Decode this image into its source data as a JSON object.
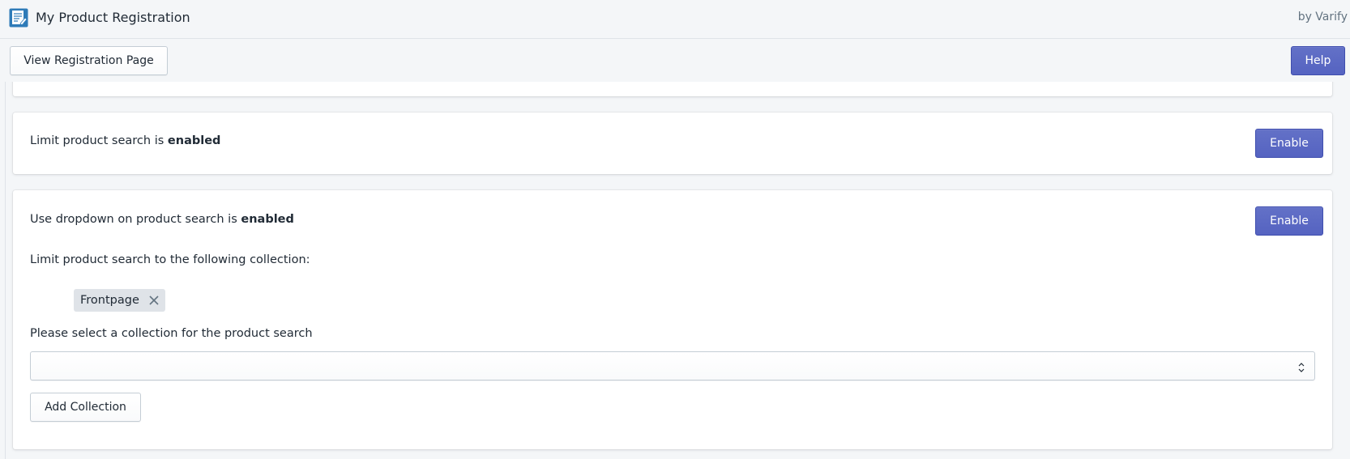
{
  "app": {
    "title": "My Product Registration",
    "vendor": "by Varify",
    "icon": "registration-form-icon"
  },
  "toolbar": {
    "view_registration_label": "View Registration Page",
    "help_label": "Help"
  },
  "limit_search_card": {
    "text_prefix": "Limit product search is ",
    "status": "enabled",
    "button_label": "Enable"
  },
  "dropdown_card": {
    "text_prefix": "Use dropdown on product search is ",
    "status": "enabled",
    "button_label": "Enable",
    "limit_label": "Limit product search to the following collection:",
    "tags": [
      {
        "label": "Frontpage",
        "remove_icon": "close-icon"
      }
    ],
    "select_label": "Please select a collection for the product search",
    "select_value": "",
    "add_button_label": "Add Collection"
  },
  "colors": {
    "primary": "#5c6ac4",
    "background": "#f4f6f8",
    "tag": "#dfe3e8"
  }
}
